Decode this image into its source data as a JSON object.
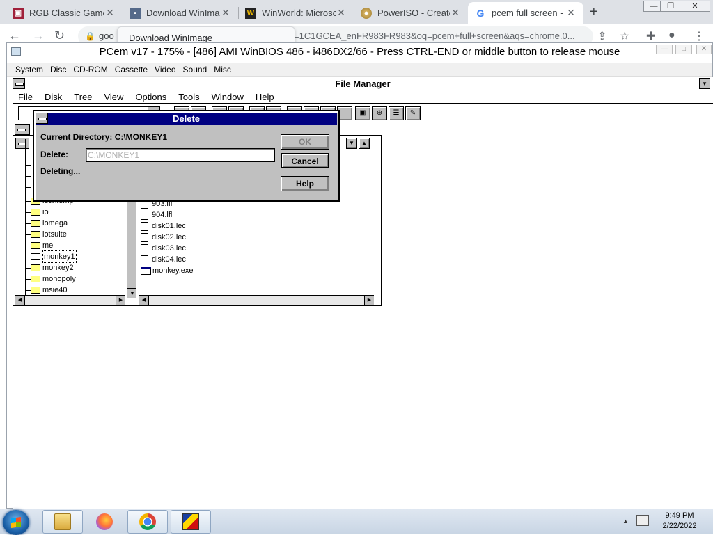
{
  "browser": {
    "tabs": [
      {
        "title": "RGB Classic Games",
        "favicon": "rgb-classic-games-icon"
      },
      {
        "title": "Download WinIma",
        "favicon": "floppy-disk-icon"
      },
      {
        "title": "WinWorld: Microsc",
        "favicon": "winworld-icon"
      },
      {
        "title": "PowerISO - Create",
        "favicon": "poweriso-disc-icon"
      },
      {
        "title": "pcem full screen - ",
        "favicon": "google-icon",
        "active": true
      }
    ],
    "tab_tooltip": "Download WinImage",
    "url_prefix": "goo",
    "url_tail": "=1C1GCEA_enFR983FR983&oq=pcem+full+screen&aqs=chrome.0..."
  },
  "pcem": {
    "title": "PCem v17 - 175% - [486] AMI WinBIOS 486 - i486DX2/66 - Press CTRL-END or middle button to release mouse",
    "menu": [
      "System",
      "Disc",
      "CD-ROM",
      "Cassette",
      "Video",
      "Sound",
      "Misc"
    ]
  },
  "file_manager": {
    "title": "File Manager",
    "menu": [
      "File",
      "Disk",
      "Tree",
      "View",
      "Options",
      "Tools",
      "Window",
      "Help"
    ],
    "tree": [
      {
        "name": "ieaktemp"
      },
      {
        "name": "io"
      },
      {
        "name": "iomega"
      },
      {
        "name": "lotsuite"
      },
      {
        "name": "me"
      },
      {
        "name": "monkey1",
        "selected": true
      },
      {
        "name": "monkey2"
      },
      {
        "name": "monopoly"
      },
      {
        "name": "msie40"
      }
    ],
    "files": [
      "903.lfl",
      "904.lfl",
      "disk01.lec",
      "disk02.lec",
      "disk03.lec",
      "disk04.lec",
      "monkey.exe"
    ]
  },
  "delete_dialog": {
    "title": "Delete",
    "current_directory_label": "Current Directory: C:\\MONKEY1",
    "delete_label": "Delete:",
    "delete_value": "C:\\MONKEY1",
    "status": "Deleting...",
    "ok_label": "OK",
    "cancel_label": "Cancel",
    "help_label": "Help"
  },
  "taskbar": {
    "time": "9:49 PM",
    "date": "2/22/2022"
  }
}
